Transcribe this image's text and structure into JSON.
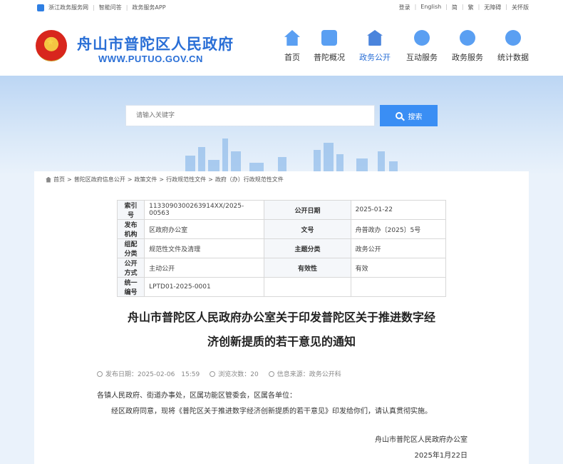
{
  "topbar": {
    "left_links": [
      "浙江政务服务网",
      "智能问答",
      "政务服务APP"
    ],
    "right_links": [
      "登录",
      "English",
      "简",
      "繁",
      "无障碍",
      "关怀版"
    ]
  },
  "header": {
    "title": "舟山市普陀区人民政府",
    "url": "WWW.PUTUO.GOV.CN"
  },
  "nav": [
    {
      "label": "首页",
      "icon": "home-icon"
    },
    {
      "label": "普陀概况",
      "icon": "image-icon"
    },
    {
      "label": "政务公开",
      "icon": "government-building-icon",
      "active": true
    },
    {
      "label": "互动服务",
      "icon": "chat-bubble-icon"
    },
    {
      "label": "政务服务",
      "icon": "hands-heart-icon"
    },
    {
      "label": "统计数据",
      "icon": "pie-chart-icon"
    }
  ],
  "search": {
    "placeholder": "请输入关键字",
    "button": "搜索"
  },
  "breadcrumb": [
    "首页",
    "普陀区政府信息公开",
    "政策文件",
    "行政规范性文件",
    "政府（办）行政规范性文件"
  ],
  "meta": {
    "index_label": "索引号",
    "index_value": "1133090300263914XX/2025-00563",
    "date_label": "公开日期",
    "date_value": "2025-01-22",
    "org_label": "发布机构",
    "org_value": "区政府办公室",
    "docno_label": "文号",
    "docno_value": "舟普政办〔2025〕5号",
    "class_label": "组配分类",
    "class_value": "规范性文件及清理",
    "topic_label": "主题分类",
    "topic_value": "政务公开",
    "mode_label": "公开方式",
    "mode_value": "主动公开",
    "valid_label": "有效性",
    "valid_value": "有效",
    "uid_label": "统一编号",
    "uid_value": "LPTD01-2025-0001"
  },
  "doc": {
    "title_line1": "舟山市普陀区人民政府办公室关于印发普陀区关于推进数字经",
    "title_line2": "济创新提质的若干意见的通知",
    "publish_date": "发布日期：2025-02-06　15:59",
    "views": "浏览次数：20",
    "source": "信息来源：政务公开科",
    "salutation": "各镇人民政府、街道办事处，区属功能区管委会，区属各单位：",
    "paragraph": "经区政府同意，现将《普陀区关于推进数字经济创新提质的若干意见》印发给你们，请认真贯彻实施。",
    "sign_org": "舟山市普陀区人民政府办公室",
    "sign_date": "2025年1月22日"
  }
}
